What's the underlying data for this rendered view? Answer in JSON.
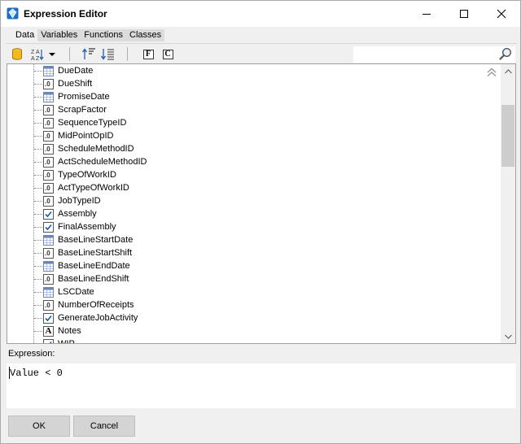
{
  "window": {
    "title": "Expression Editor",
    "controls": {
      "minimize": "minimize",
      "maximize": "maximize",
      "close": "close"
    }
  },
  "tabs": [
    {
      "label": "Data",
      "active": true
    },
    {
      "label": "Variables",
      "active": false
    },
    {
      "label": "Functions",
      "active": false
    },
    {
      "label": "Classes",
      "active": false
    }
  ],
  "toolbar": {
    "items": [
      "database-icon",
      "sort-az-icon",
      "dropdown-arrow-icon",
      "sort-ascending-icon",
      "sort-descending-icon"
    ],
    "f_label": "F",
    "c_label": "C",
    "search_value": "",
    "search_icon": "magnifier-icon"
  },
  "tree": {
    "items": [
      {
        "label": "DueDate",
        "type": "date"
      },
      {
        "label": "DueShift",
        "type": "number"
      },
      {
        "label": "PromiseDate",
        "type": "date"
      },
      {
        "label": "ScrapFactor",
        "type": "number"
      },
      {
        "label": "SequenceTypeID",
        "type": "number"
      },
      {
        "label": "MidPointOpID",
        "type": "number"
      },
      {
        "label": "ScheduleMethodID",
        "type": "number"
      },
      {
        "label": "ActScheduleMethodID",
        "type": "number"
      },
      {
        "label": "TypeOfWorkID",
        "type": "number"
      },
      {
        "label": "ActTypeOfWorkID",
        "type": "number"
      },
      {
        "label": "JobTypeID",
        "type": "number"
      },
      {
        "label": "Assembly",
        "type": "boolean"
      },
      {
        "label": "FinalAssembly",
        "type": "boolean"
      },
      {
        "label": "BaseLineStartDate",
        "type": "date"
      },
      {
        "label": "BaseLineStartShift",
        "type": "number"
      },
      {
        "label": "BaseLineEndDate",
        "type": "date"
      },
      {
        "label": "BaseLineEndShift",
        "type": "number"
      },
      {
        "label": "LSCDate",
        "type": "date"
      },
      {
        "label": "NumberOfReceipts",
        "type": "number"
      },
      {
        "label": "GenerateJobActivity",
        "type": "boolean"
      },
      {
        "label": "Notes",
        "type": "text"
      },
      {
        "label": "WIP",
        "type": "boolean"
      }
    ],
    "number_icon_text": ".0",
    "text_icon_text": "A"
  },
  "expression": {
    "label": "Expression:",
    "value": "Value < 0"
  },
  "buttons": {
    "ok": "OK",
    "cancel": "Cancel"
  },
  "colors": {
    "accent_blue": "#1a6fc4",
    "title_bg": "#ffffff",
    "window_bg": "#f0f0f0",
    "check_blue": "#1a5fb4"
  }
}
